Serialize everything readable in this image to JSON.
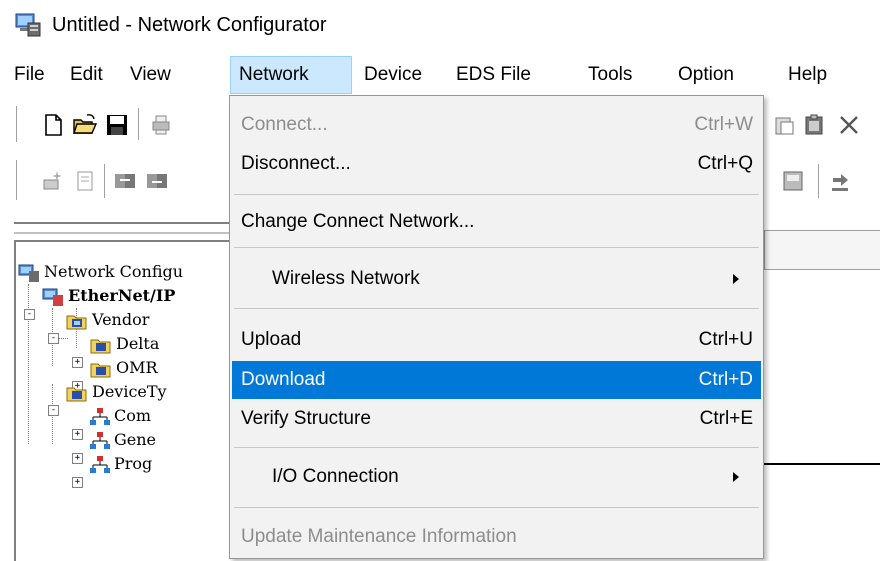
{
  "window": {
    "title": "Untitled - Network Configurator",
    "app_icon": "network-configurator-icon"
  },
  "menubar": {
    "items": [
      {
        "label": "File"
      },
      {
        "label": "Edit"
      },
      {
        "label": "View"
      },
      {
        "label": "Network",
        "active": true
      },
      {
        "label": "Device"
      },
      {
        "label": "EDS File"
      },
      {
        "label": "Tools"
      },
      {
        "label": "Option"
      },
      {
        "label": "Help"
      }
    ]
  },
  "network_menu": {
    "items": [
      {
        "label": "Connect...",
        "shortcut": "Ctrl+W",
        "state": "disabled"
      },
      {
        "label": "Disconnect...",
        "shortcut": "Ctrl+Q"
      },
      {
        "label": "Change Connect Network..."
      },
      {
        "label": "Wireless Network",
        "submenu": true
      },
      {
        "label": "Upload",
        "shortcut": "Ctrl+U"
      },
      {
        "label": "Download",
        "shortcut": "Ctrl+D",
        "state": "highlighted"
      },
      {
        "label": "Verify Structure",
        "shortcut": "Ctrl+E"
      },
      {
        "label": "I/O Connection",
        "submenu": true
      },
      {
        "label": "Update Maintenance Information",
        "state": "disabled"
      }
    ]
  },
  "tree": {
    "items": [
      {
        "label": "Network Configu",
        "icon": "network-configurator-icon"
      },
      {
        "label": "EtherNet/IP",
        "icon": "ethernet-ip-icon"
      },
      {
        "label": "Vendor",
        "icon": "folder-icon"
      },
      {
        "label": "Delta",
        "icon": "folder-icon"
      },
      {
        "label": "OMR",
        "icon": "folder-icon"
      },
      {
        "label": "DeviceTy",
        "icon": "folder-icon"
      },
      {
        "label": "Com",
        "icon": "device-tree-icon"
      },
      {
        "label": "Gene",
        "icon": "device-tree-icon"
      },
      {
        "label": "Prog",
        "icon": "device-tree-icon"
      }
    ]
  },
  "colors": {
    "highlight": "#0078d7",
    "menu_bg": "#f2f2f2",
    "menubar_active": "#cce8ff",
    "disabled_text": "#8d8d8d"
  }
}
